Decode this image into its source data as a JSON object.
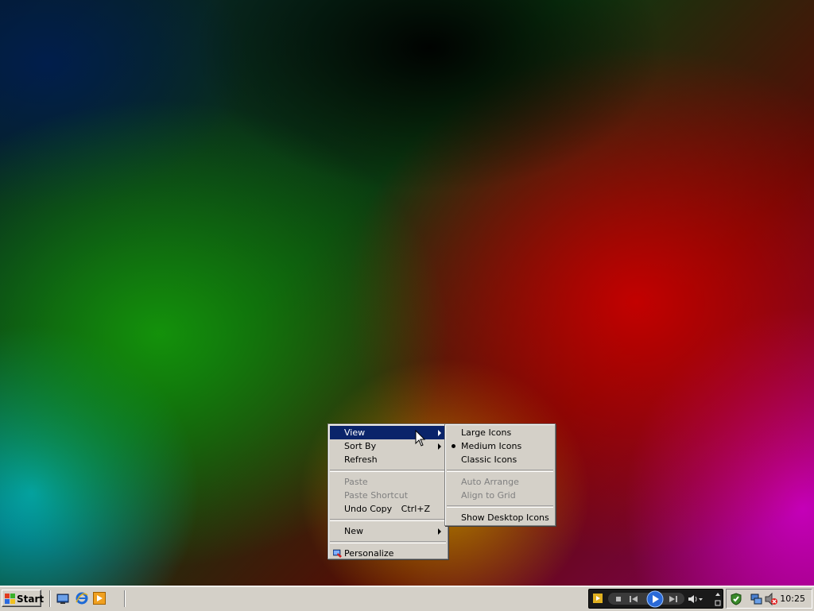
{
  "context_menu": {
    "items": [
      {
        "label": "View",
        "state": "highlighted",
        "submenu": true
      },
      {
        "label": "Sort By",
        "submenu": true
      },
      {
        "label": "Refresh"
      },
      {
        "label": "Paste",
        "disabled": true
      },
      {
        "label": "Paste Shortcut",
        "disabled": true
      },
      {
        "label": "Undo Copy",
        "shortcut": "Ctrl+Z"
      },
      {
        "label": "New",
        "submenu": true
      },
      {
        "label": "Personalize",
        "icon": "personalize-icon"
      }
    ]
  },
  "view_submenu": {
    "items": [
      {
        "label": "Large Icons"
      },
      {
        "label": "Medium Icons",
        "checked": true
      },
      {
        "label": "Classic Icons"
      },
      {
        "label": "Auto Arrange",
        "disabled": true
      },
      {
        "label": "Align to Grid",
        "disabled": true
      },
      {
        "label": "Show Desktop Icons"
      }
    ]
  },
  "taskbar": {
    "start_label": "Start",
    "quick_launch": [
      "show-desktop-icon",
      "internet-explorer-icon",
      "media-player-icon"
    ],
    "clock": "10:25"
  },
  "colors": {
    "menu_bg": "#d4d0c8",
    "highlight": "#0a246a"
  }
}
